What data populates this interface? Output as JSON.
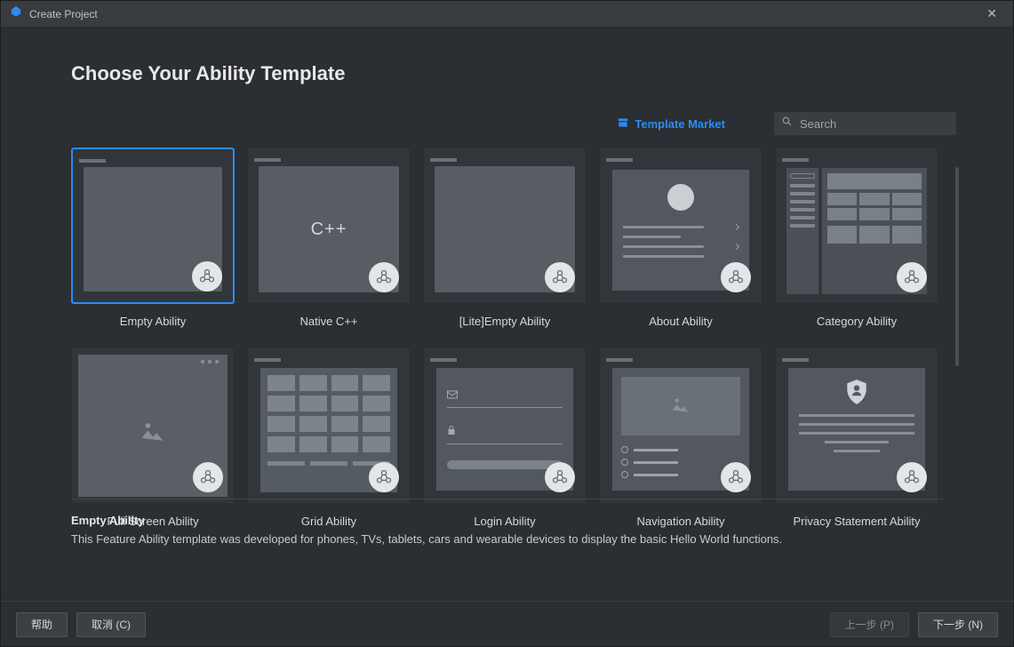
{
  "window": {
    "title": "Create Project"
  },
  "heading": "Choose Your Ability Template",
  "market_link": "Template Market",
  "search": {
    "placeholder": "Search"
  },
  "templates": [
    {
      "name": "Empty Ability",
      "kind": "empty"
    },
    {
      "name": "Native C++",
      "kind": "cpp"
    },
    {
      "name": "[Lite]Empty Ability",
      "kind": "empty"
    },
    {
      "name": "About Ability",
      "kind": "about"
    },
    {
      "name": "Category Ability",
      "kind": "category"
    },
    {
      "name": "Full Screen Ability",
      "kind": "fullscreen"
    },
    {
      "name": "Grid Ability",
      "kind": "grid"
    },
    {
      "name": "Login Ability",
      "kind": "login"
    },
    {
      "name": "Navigation Ability",
      "kind": "navigation"
    },
    {
      "name": "Privacy Statement Ability",
      "kind": "privacy"
    }
  ],
  "selected_index": 0,
  "description": {
    "title": "Empty Ability",
    "text": "This Feature Ability template was developed for phones, TVs, tablets, cars and wearable devices to display the basic Hello World functions."
  },
  "buttons": {
    "help": "帮助",
    "cancel": "取消 (C)",
    "prev": "上一步 (P)",
    "next": "下一步 (N)"
  }
}
